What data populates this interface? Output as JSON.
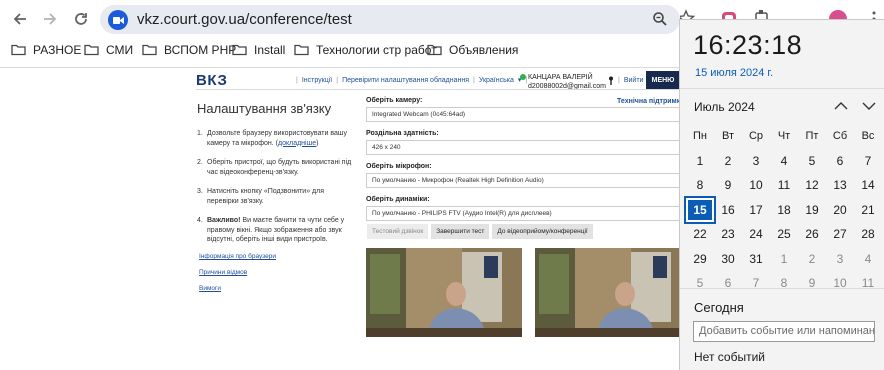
{
  "browser": {
    "url": "vkz.court.gov.ua/conference/test",
    "bookmarks": [
      "РАЗНОЕ",
      "СМИ",
      "ВСПОМ РНР",
      "Install",
      "Технологии стр работ",
      "Объявления"
    ]
  },
  "site": {
    "logo": "ВКЗ",
    "nav": [
      "Інструкції",
      "Перевірити налаштування обладнання",
      "Українська"
    ],
    "user_name": "КАНЦАРА ВАЛЕРІЙ",
    "user_id": "d20088002d@gmail.com",
    "exit_label": "Вийти",
    "menu_label": "МЕНЮ"
  },
  "setup": {
    "title": "Налаштування зв'язку",
    "steps": [
      {
        "num": "1.",
        "text": "Дозвольте браузеру використовувати вашу камеру та мікрофон. (",
        "link": "докладніше",
        "tail": ")"
      },
      {
        "num": "2.",
        "text": "Оберіть пристрої, що будуть використані під час відеоконференц-зв'язку."
      },
      {
        "num": "3.",
        "text": "Натисніть кнопку «Подзвонити» для перевірки зв'язку."
      },
      {
        "num": "4.",
        "bold": "Важливо!",
        "text": " Ви маєте бачити та чути себе у правому вікні. Якщо зображення або звук відсутні, оберіть інші види пристроїв."
      }
    ],
    "links": [
      "Інформація про браузери",
      "Причини відмов",
      "Вимоги"
    ]
  },
  "form": {
    "support_label": "Технічна підтримка",
    "camera_label": "Оберіть камеру:",
    "camera_value": "Integrated Webcam (0c45:64ad)",
    "resolution_label": "Роздільна здатність:",
    "resolution_value": "426 x 240",
    "mic_label": "Оберіть мікрофон:",
    "mic_value": "По умолчанию - Микрофон (Realtek High Definition Audio)",
    "speaker_label": "Оберіть динаміки:",
    "speaker_value": "По умолчанию - PHILIPS FTV (Аудио Intel(R) для дисплеев)",
    "buttons": [
      "Тестовий дзвінок",
      "Завершити тест",
      "До відеоприйому/конференції"
    ]
  },
  "calendar": {
    "time": "16:23:18",
    "date": "15 июля 2024 г.",
    "month": "Июль 2024",
    "weekdays": [
      "Пн",
      "Вт",
      "Ср",
      "Чт",
      "Пт",
      "Сб",
      "Вс"
    ],
    "weeks": [
      [
        "1",
        "2",
        "3",
        "4",
        "5",
        "6",
        "7"
      ],
      [
        "8",
        "9",
        "10",
        "11",
        "12",
        "13",
        "14"
      ],
      [
        "15",
        "16",
        "17",
        "18",
        "19",
        "20",
        "21"
      ],
      [
        "22",
        "23",
        "24",
        "25",
        "26",
        "27",
        "28"
      ],
      [
        "29",
        "30",
        "31",
        "1",
        "2",
        "3",
        "4"
      ],
      [
        "5",
        "6",
        "7",
        "8",
        "9",
        "10",
        "11"
      ]
    ],
    "today_label": "Сегодня",
    "event_placeholder": "Добавить событие или напоминание",
    "no_events": "Нет событий"
  }
}
